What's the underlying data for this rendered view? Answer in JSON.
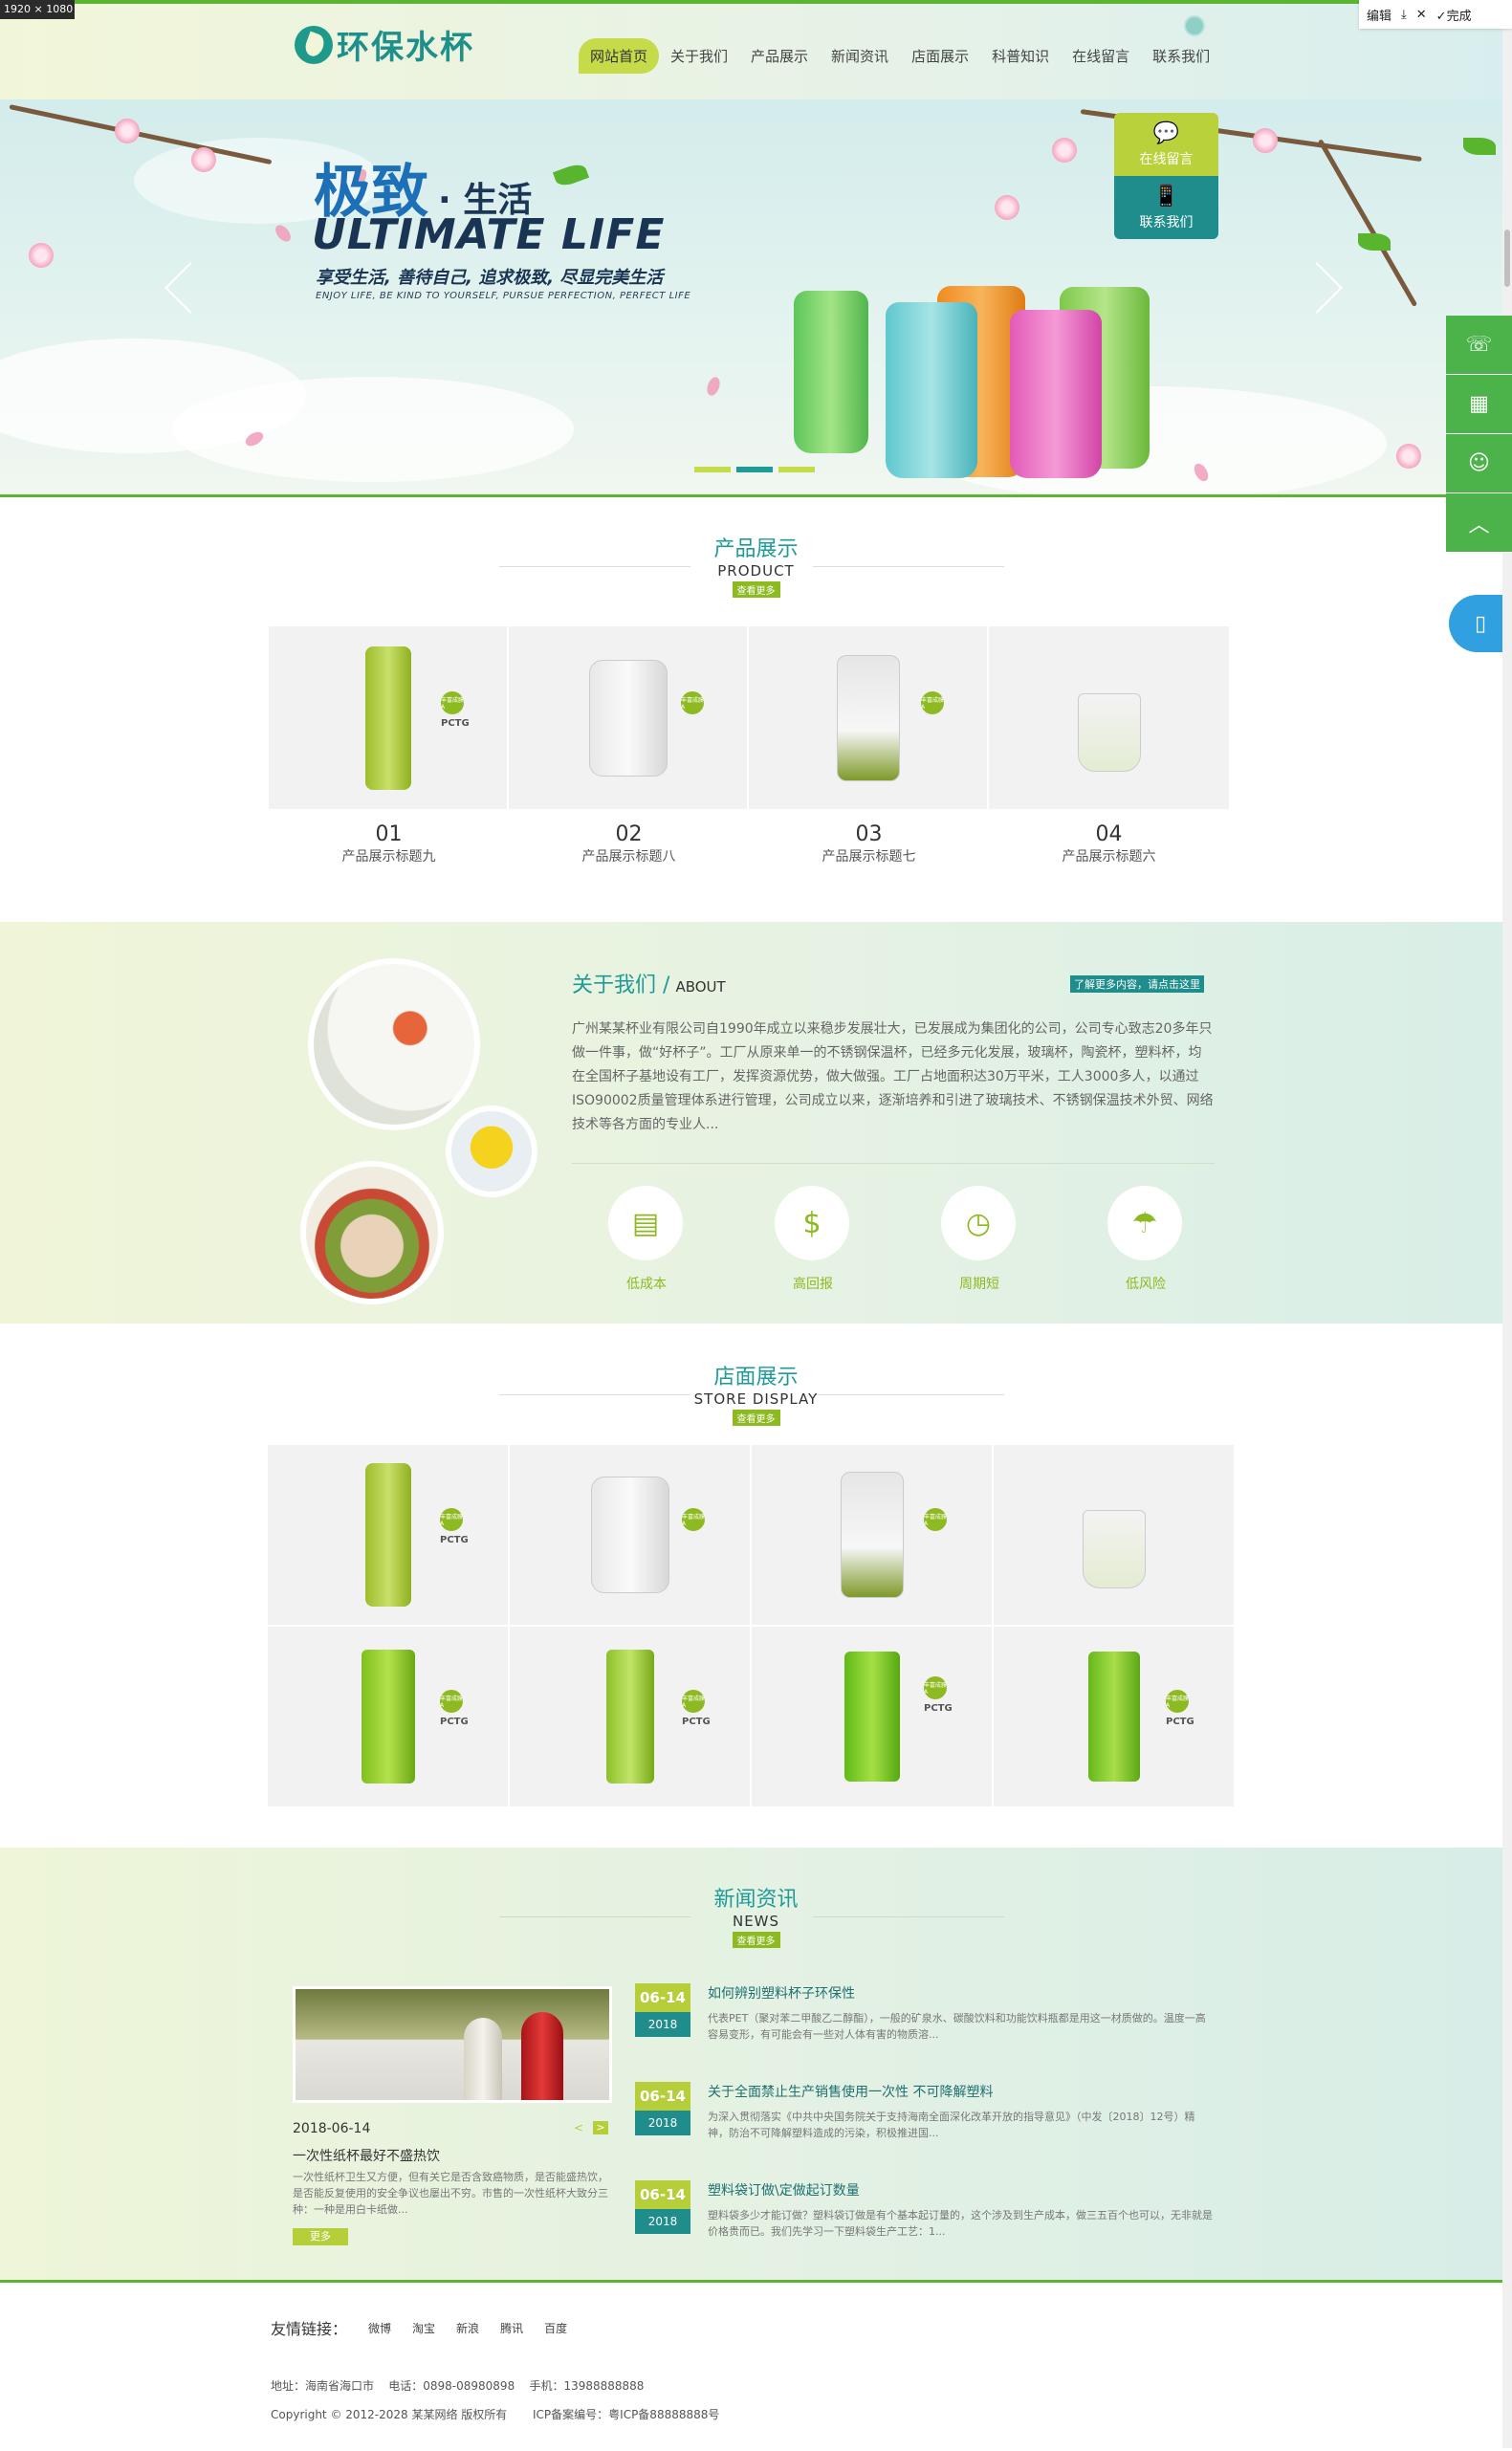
{
  "editor": {
    "dim_label": "1920 × 1080",
    "edit_label": "编辑",
    "done_label": "完成"
  },
  "brand": {
    "logo_text": "环保水杯"
  },
  "nav": {
    "items": [
      "网站首页",
      "关于我们",
      "产品展示",
      "新闻资讯",
      "店面展示",
      "科普知识",
      "在线留言",
      "联系我们"
    ],
    "active_index": 0
  },
  "banner": {
    "headline_cn": "极致",
    "headline_cn_small": "· 生活",
    "headline_en": "ULTIMATE  LIFE",
    "tagline_cn": "享受生活, 善待自己, 追求极致, 尽显完美生活",
    "tagline_en": "ENJOY LIFE, BE KIND TO YOURSELF, PURSUE PERFECTION, PERFECT LIFE",
    "slides": 3,
    "active_slide": 1
  },
  "float_widget": {
    "message_label": "在线留言",
    "contact_label": "联系我们"
  },
  "sidebar_icons": [
    "phone-icon",
    "qrcode-icon",
    "qq-icon",
    "back-to-top-icon"
  ],
  "product_section": {
    "title_cn": "产品展示",
    "title_en": "PRODUCT",
    "more_label": "查看更多",
    "items": [
      {
        "num": "01",
        "label": "产品展示标题九"
      },
      {
        "num": "02",
        "label": "产品展示标题八"
      },
      {
        "num": "03",
        "label": "产品展示标题七"
      },
      {
        "num": "04",
        "label": "产品展示标题六"
      }
    ],
    "pctg_text": "PCTG",
    "badge_text": "丰富成膜A"
  },
  "about": {
    "title_cn": "关于我们",
    "title_sep": "/",
    "title_en": "ABOUT",
    "more_link": "了解更多内容，请点击这里",
    "text": "广州某某杯业有限公司自1990年成立以来稳步发展壮大，已发展成为集团化的公司，公司专心致志20多年只做一件事，做“好杯子”。工厂从原来单一的不锈钢保温杯，已经多元化发展，玻璃杯，陶瓷杯，塑料杯，均在全国杯子基地设有工厂，发挥资源优势，做大做强。工厂占地面积达30万平米，工人3000多人，以通过ISO90002质量管理体系进行管理，公司成立以来，逐渐培养和引进了玻璃技术、不锈钢保温技术外贸、网络技术等各方面的专业人...",
    "features": [
      {
        "label": "低成本",
        "icon": "calculator-icon"
      },
      {
        "label": "高回报",
        "icon": "money-bag-icon"
      },
      {
        "label": "周期短",
        "icon": "clock-icon"
      },
      {
        "label": "低风险",
        "icon": "umbrella-icon"
      }
    ]
  },
  "store_section": {
    "title_cn": "店面展示",
    "title_en": "STORE DISPLAY",
    "more_label": "查看更多"
  },
  "news_section": {
    "title_cn": "新闻资讯",
    "title_en": "NEWS",
    "more_label": "查看更多",
    "featured": {
      "date": "2018-06-14",
      "title": "一次性纸杯最好不盛热饮",
      "desc": "一次性纸杯卫生又方便，但有关它是否含致癌物质，是否能盛热饮，是否能反复使用的安全争议也屡出不穷。市售的一次性纸杯大致分三种：一种是用白卡纸做...",
      "more_label": "更多",
      "prev": "<",
      "next": ">"
    },
    "items": [
      {
        "day": "06-14",
        "year": "2018",
        "title": "如何辨别塑料杯子环保性",
        "desc": "代表PET（聚对苯二甲酸乙二醇酯），一般的矿泉水、碳酸饮料和功能饮料瓶都是用这一材质做的。温度一高容易变形，有可能会有一些对人体有害的物质溶..."
      },
      {
        "day": "06-14",
        "year": "2018",
        "title": "关于全面禁止生产销售使用一次性 不可降解塑料",
        "desc": "为深入贯彻落实《中共中央国务院关于支持海南全面深化改革开放的指导意见》（中发〔2018〕12号）精神，防治不可降解塑料造成的污染，积极推进国..."
      },
      {
        "day": "06-14",
        "year": "2018",
        "title": "塑料袋订做\\定做起订数量",
        "desc": "塑料袋多少才能订做？塑料袋订做是有个基本起订量的，这个涉及到生产成本，做三五百个也可以，无非就是价格贵而已。我们先学习一下塑料袋生产工艺：1..."
      }
    ]
  },
  "footer": {
    "links_heading": "友情链接：",
    "links": [
      "微博",
      "淘宝",
      "新浪",
      "腾讯",
      "百度"
    ],
    "address": "地址：海南省海口市    电话：0898-08980898    手机：13988888888",
    "copyright": "Copyright © 2012-2028 某某网络 版权所有       ICP备案编号：粤ICP备88888888号"
  },
  "colors": {
    "accent_green": "#5cb531",
    "teal": "#1e9a97",
    "lime": "#c5db49",
    "date_green": "#b5ce3a",
    "side_green": "#4cb24a",
    "phone_blue": "#31a0e0"
  }
}
